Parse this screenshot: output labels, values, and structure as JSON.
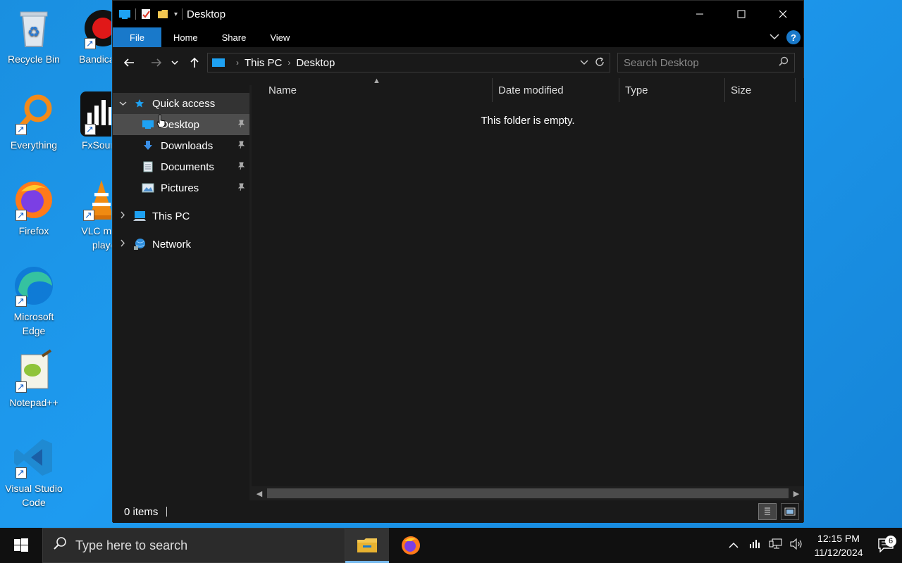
{
  "desktop": {
    "icons": [
      {
        "label": "Recycle Bin"
      },
      {
        "label": "Bandicam"
      },
      {
        "label": "Everything"
      },
      {
        "label": "FxSound"
      },
      {
        "label": "Firefox"
      },
      {
        "label": "VLC media player"
      },
      {
        "label": "Microsoft Edge"
      },
      {
        "label": "Notepad++"
      },
      {
        "label": "Visual Studio Code"
      }
    ]
  },
  "window": {
    "title": "Desktop",
    "ribbon_tabs": [
      "File",
      "Home",
      "Share",
      "View"
    ],
    "help_label": "?",
    "address": {
      "crumbs": [
        "This PC",
        "Desktop"
      ]
    },
    "search": {
      "placeholder": "Search Desktop"
    },
    "nav_pane": {
      "quick_access": "Quick access",
      "items": [
        {
          "label": "Desktop",
          "pinned": true
        },
        {
          "label": "Downloads",
          "pinned": true
        },
        {
          "label": "Documents",
          "pinned": true
        },
        {
          "label": "Pictures",
          "pinned": true
        }
      ],
      "this_pc": "This PC",
      "network": "Network"
    },
    "columns": [
      "Name",
      "Date modified",
      "Type",
      "Size"
    ],
    "empty_message": "This folder is empty.",
    "status": {
      "item_count": "0 items"
    }
  },
  "taskbar": {
    "search_placeholder": "Type here to search",
    "time": "12:15 PM",
    "date": "11/12/2024",
    "notification_count": "6"
  },
  "colors": {
    "accent": "#1979ca",
    "desktop_bg": "#1e9bf0",
    "window_bg": "#191919"
  }
}
